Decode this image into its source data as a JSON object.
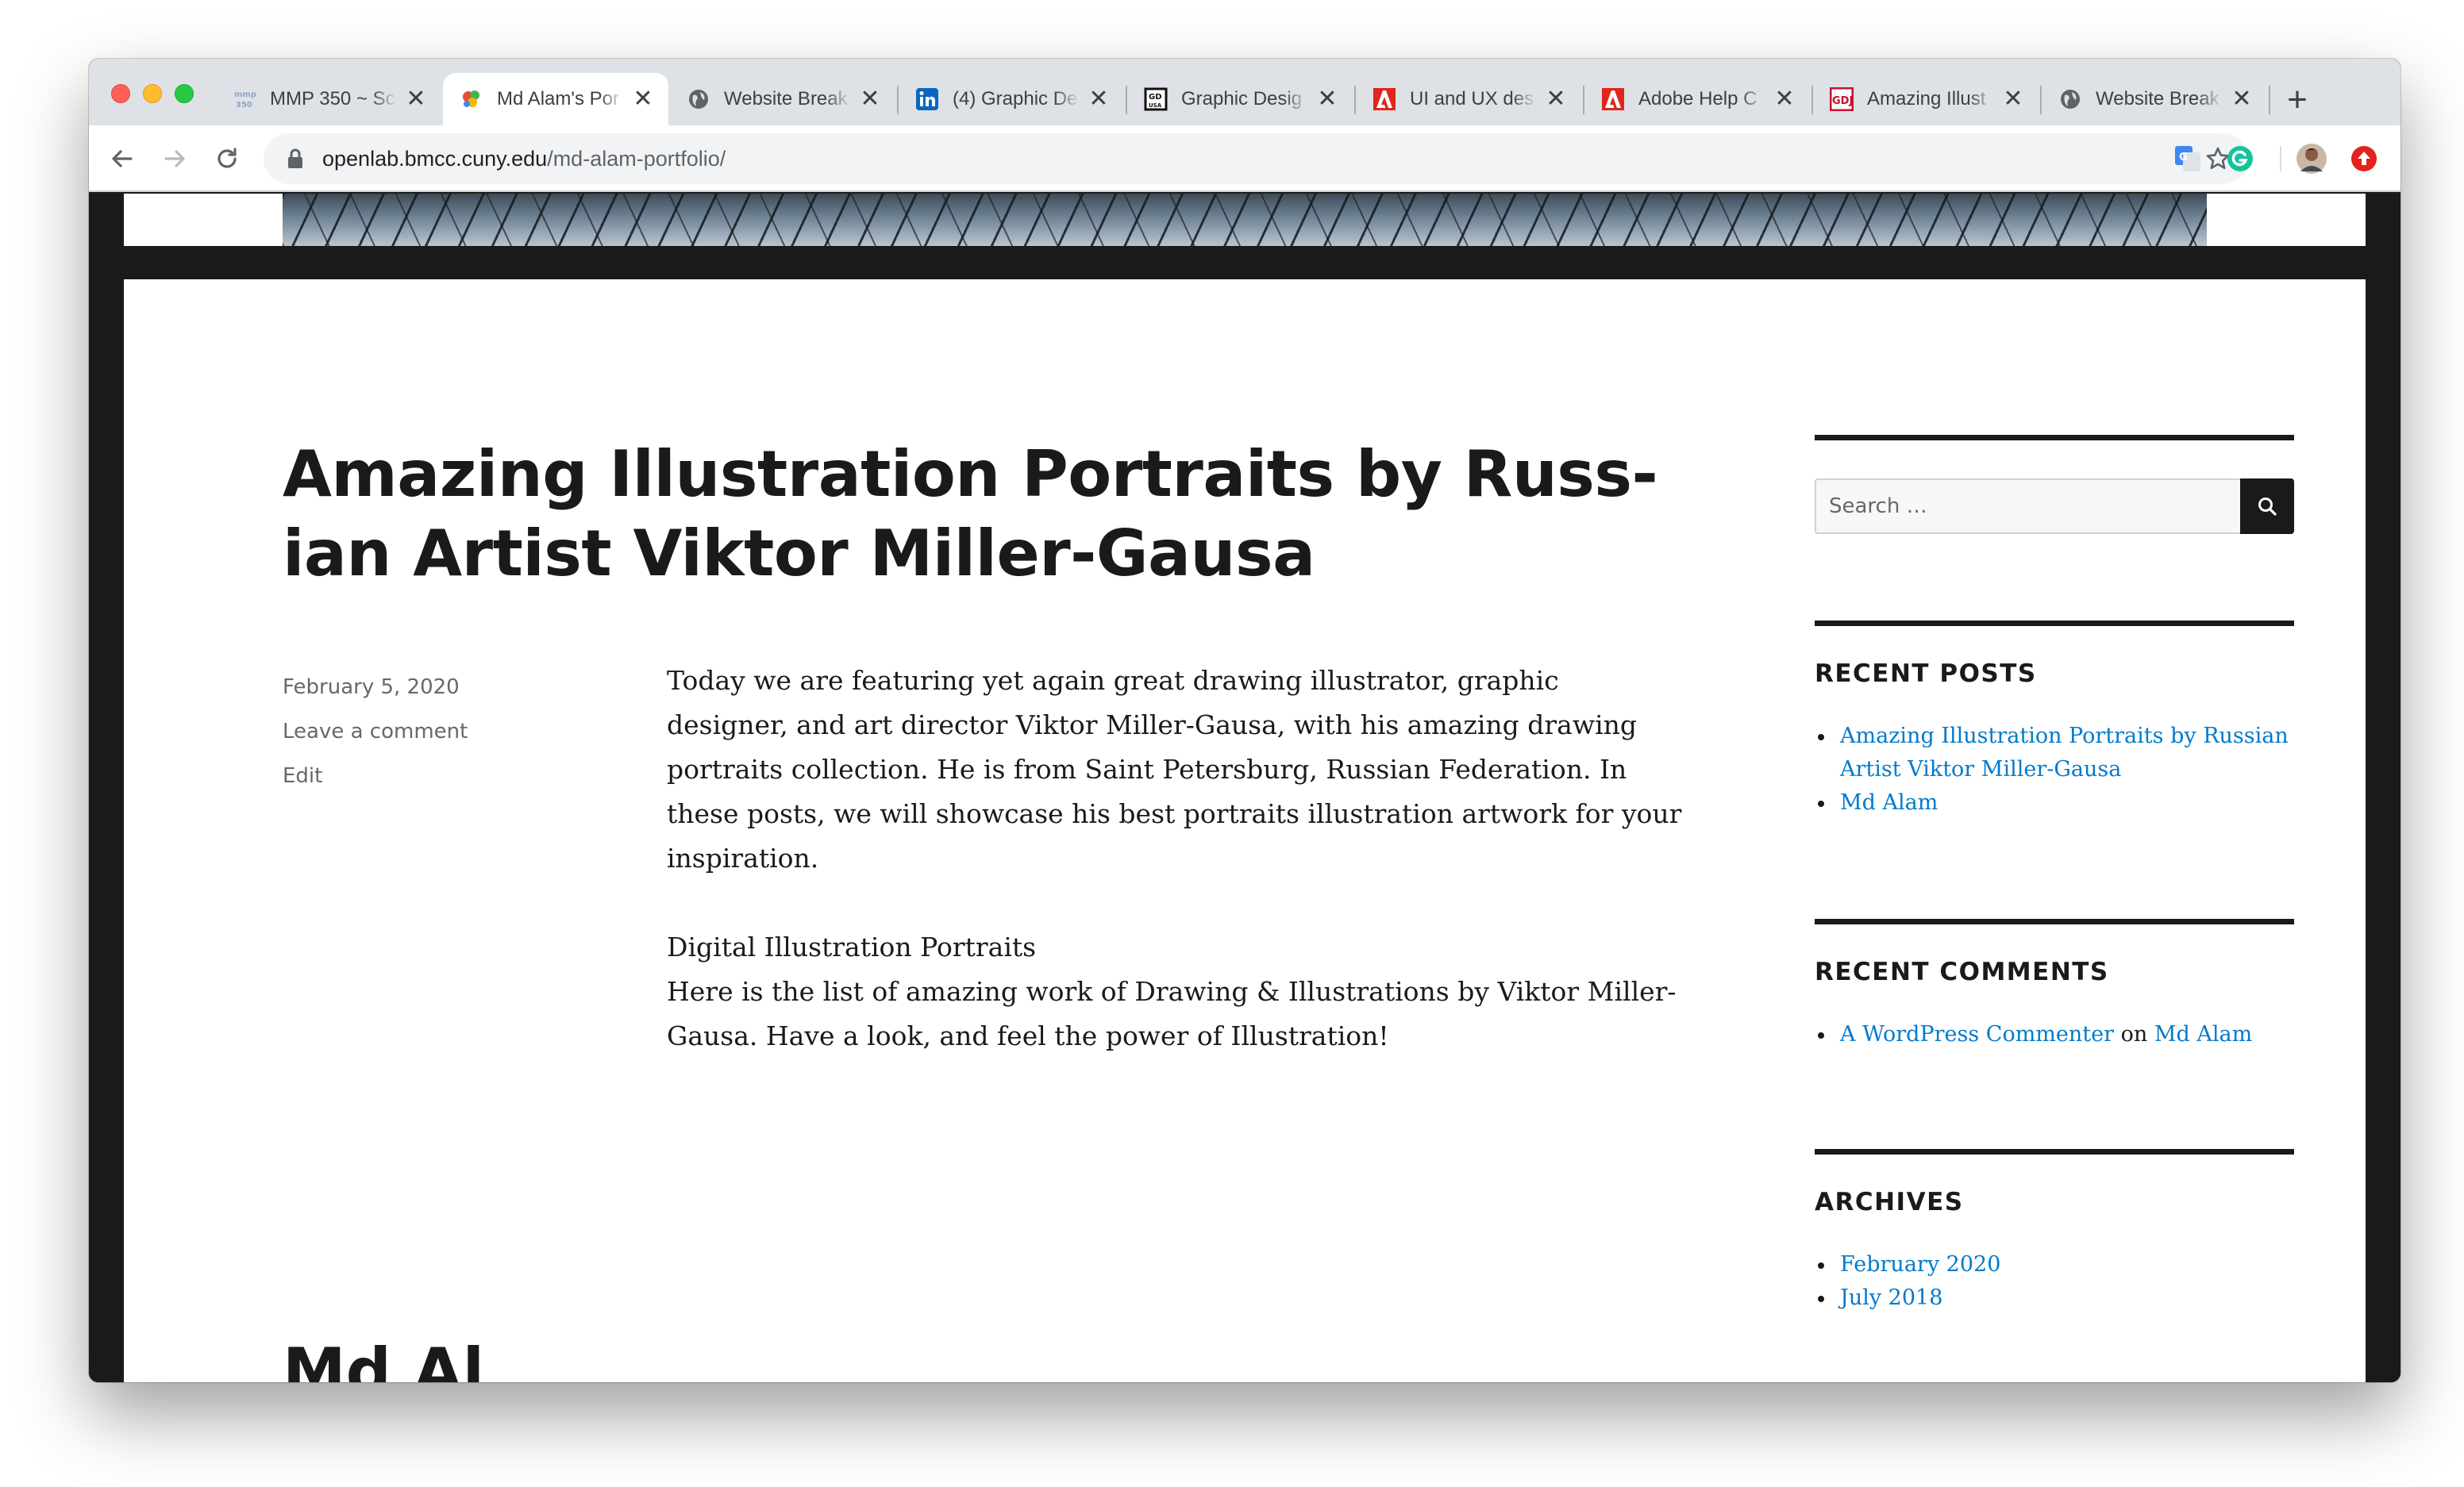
{
  "browser": {
    "tabs": [
      {
        "title": "MMP 350 ~ Sc",
        "icon": "mmp-favicon",
        "active": false
      },
      {
        "title": "Md Alam's Por",
        "icon": "openlab-favicon",
        "active": true
      },
      {
        "title": "Website Break",
        "icon": "globe-icon",
        "active": false
      },
      {
        "title": "(4) Graphic De",
        "icon": "linkedin-icon",
        "active": false
      },
      {
        "title": "Graphic Desig",
        "icon": "gd-usa-icon",
        "active": false
      },
      {
        "title": "UI and UX des",
        "icon": "adobe-icon",
        "active": false
      },
      {
        "title": "Adobe Help C",
        "icon": "adobe-icon",
        "active": false
      },
      {
        "title": "Amazing Illust",
        "icon": "gdj-icon",
        "active": false
      },
      {
        "title": "Website Break",
        "icon": "globe-icon",
        "active": false
      }
    ],
    "tab_close_glyph": "✕",
    "new_tab_glyph": "+",
    "favicon_text": {
      "mmp": "mmp\n350",
      "linkedin": "in",
      "gd": "GD\nUSA",
      "adobe": "A",
      "gdj": "GDJ"
    },
    "url_domain": "openlab.bmcc.cuny.edu",
    "url_path": "/md-alam-portfolio/",
    "colors": {
      "tabstrip": "#dee1e6",
      "linkedin": "#0a66c2",
      "adobe": "#e1251b",
      "gdj": "#c8102e"
    }
  },
  "post": {
    "title_lines": [
      "Amazing Illustration Portraits by Russ-",
      "ian Artist Viktor Miller-Gausa"
    ],
    "date": "February 5, 2020",
    "comment_link": "Leave a comment",
    "edit_link": "Edit",
    "paragraph1_lines": [
      "Today we are featuring yet again great drawing illustrator, graphic",
      "designer, and art director Viktor Miller-Gausa, with his amazing drawing",
      "portraits collection. He is from Saint Petersburg, Russian Federation. In",
      "these posts, we will showcase his best portraits illustration artwork for your",
      "inspiration."
    ],
    "paragraph2_lines": [
      "Digital Illustration Portraits",
      "Here is the list of amazing work of Drawing & Illustrations by Viktor Miller-",
      "Gausa. Have a look, and feel the power of Illustration!"
    ],
    "next_title_partial": "Md Al"
  },
  "sidebar": {
    "search_placeholder": "Search …",
    "recent_posts": {
      "heading": "RECENT POSTS",
      "items": [
        {
          "lines": [
            "Amazing Illustration Portraits by Russian",
            "Artist Viktor Miller-Gausa"
          ]
        },
        {
          "lines": [
            "Md Alam"
          ]
        }
      ]
    },
    "recent_comments": {
      "heading": "RECENT COMMENTS",
      "author": "A WordPress Commenter",
      "connector": "on",
      "post": "Md Alam"
    },
    "archives": {
      "heading": "ARCHIVES",
      "items": [
        "February 2020",
        "July 2018"
      ]
    },
    "link_color": "#007acc"
  }
}
